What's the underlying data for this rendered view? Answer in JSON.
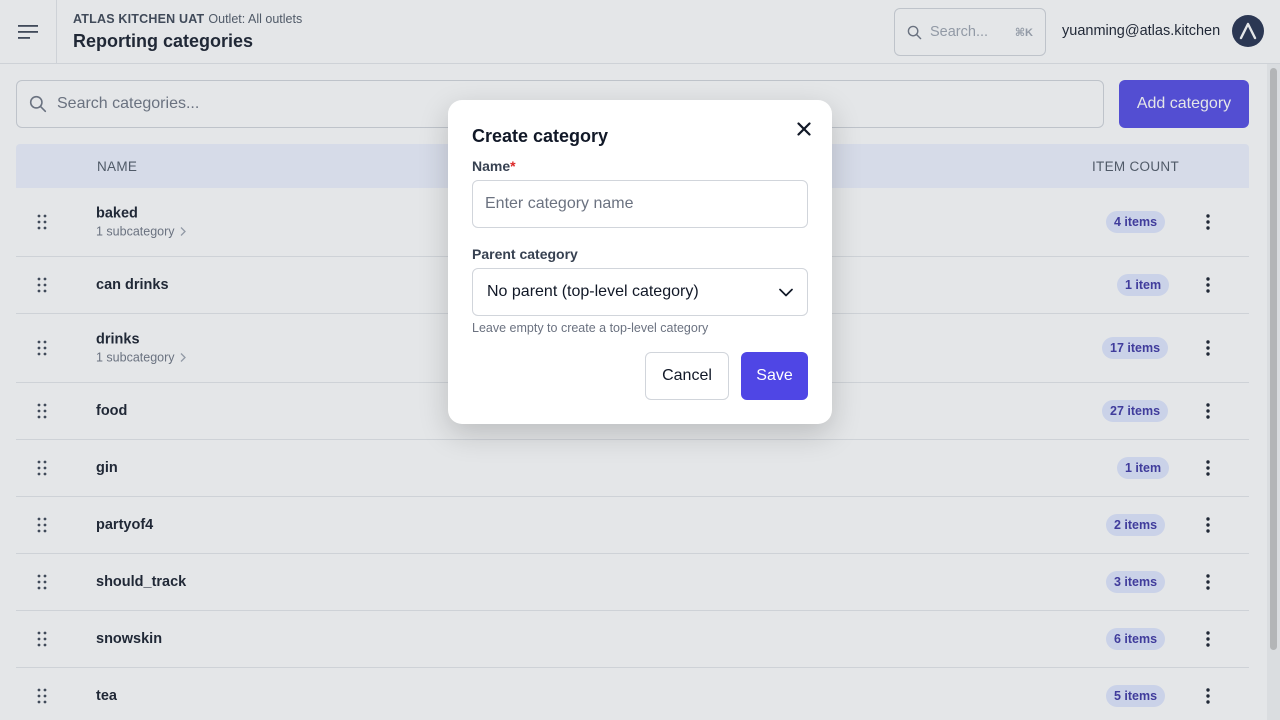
{
  "header": {
    "org": "ATLAS KITCHEN UAT",
    "outlet": "Outlet: All outlets",
    "title": "Reporting categories",
    "search_placeholder": "Search...",
    "search_shortcut": "⌘K",
    "user_email": "yuanming@atlas.kitchen"
  },
  "toolbar": {
    "search_placeholder": "Search categories...",
    "add_label": "Add category"
  },
  "table": {
    "col_name": "NAME",
    "col_count": "ITEM COUNT",
    "rows": [
      {
        "name": "baked",
        "sub": "1 subcategory",
        "count": "4 items"
      },
      {
        "name": "can drinks",
        "sub": "",
        "count": "1 item"
      },
      {
        "name": "drinks",
        "sub": "1 subcategory",
        "count": "17 items"
      },
      {
        "name": "food",
        "sub": "",
        "count": "27 items"
      },
      {
        "name": "gin",
        "sub": "",
        "count": "1 item"
      },
      {
        "name": "partyof4",
        "sub": "",
        "count": "2 items"
      },
      {
        "name": "should_track",
        "sub": "",
        "count": "3 items"
      },
      {
        "name": "snowskin",
        "sub": "",
        "count": "6 items"
      },
      {
        "name": "tea",
        "sub": "",
        "count": "5 items"
      }
    ]
  },
  "modal": {
    "title": "Create category",
    "name_label": "Name",
    "required_mark": "*",
    "name_placeholder": "Enter category name",
    "parent_label": "Parent category",
    "parent_value": "No parent (top-level category)",
    "hint": "Leave empty to create a top-level category",
    "cancel_label": "Cancel",
    "save_label": "Save"
  },
  "colors": {
    "accent": "#4f46e5",
    "badge_bg": "#e0e7ff",
    "badge_text": "#3730a3",
    "header_row_bg": "#eef2ff",
    "avatar_bg": "#1e2a4a",
    "required": "#dc2626"
  },
  "icons": {
    "menu": "menu-icon",
    "search": "search-icon",
    "avatar": "logo-icon",
    "drag": "drag-handle-icon",
    "subcategory": "chevron-right-icon",
    "row_actions": "more-vertical-icon",
    "close": "close-icon",
    "select": "chevron-down-icon"
  }
}
